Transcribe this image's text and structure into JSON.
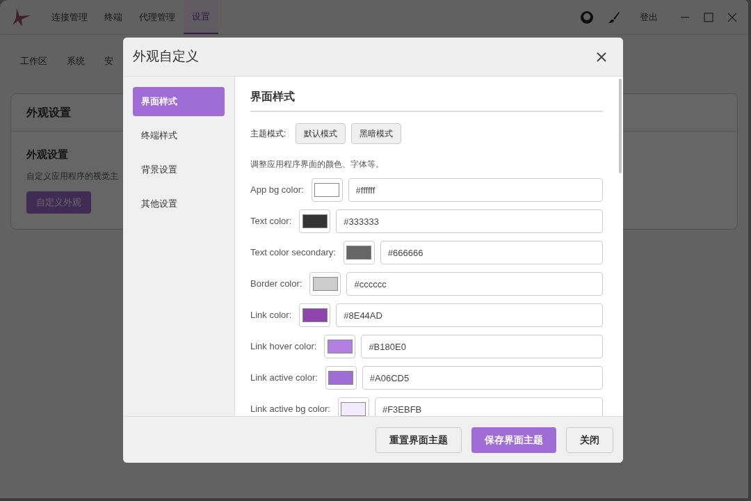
{
  "header": {
    "nav": [
      {
        "label": "连接管理",
        "selected": false
      },
      {
        "label": "终端",
        "selected": false
      },
      {
        "label": "代理管理",
        "selected": false
      },
      {
        "label": "设置",
        "selected": true
      }
    ],
    "logout": "登出"
  },
  "subtabs": [
    {
      "label": "工作区"
    },
    {
      "label": "系统"
    },
    {
      "label": "安"
    }
  ],
  "card": {
    "title": "外观设置",
    "section_title": "外观设置",
    "description": "自定义应用程序的视觉主",
    "button": "自定义外观"
  },
  "dialog": {
    "title": "外观自定义",
    "sidebar": [
      {
        "label": "界面样式",
        "selected": true
      },
      {
        "label": "终端样式",
        "selected": false
      },
      {
        "label": "背景设置",
        "selected": false
      },
      {
        "label": "其他设置",
        "selected": false
      }
    ],
    "heading": "界面样式",
    "theme_mode": {
      "label": "主题模式:",
      "options": [
        "默认模式",
        "黑暗模式"
      ]
    },
    "description": "调整应用程序界面的颜色、字体等。",
    "fields": [
      {
        "label": "App bg color:",
        "color": "#ffffff",
        "value": "#ffffff"
      },
      {
        "label": "Text color:",
        "color": "#333333",
        "value": "#333333"
      },
      {
        "label": "Text color secondary:",
        "color": "#666666",
        "value": "#666666"
      },
      {
        "label": "Border color:",
        "color": "#cccccc",
        "value": "#cccccc"
      },
      {
        "label": "Link color:",
        "color": "#8e44ad",
        "value": "#8E44AD"
      },
      {
        "label": "Link hover color:",
        "color": "#b180e0",
        "value": "#B180E0"
      },
      {
        "label": "Link active color:",
        "color": "#a06cd5",
        "value": "#A06CD5"
      },
      {
        "label": "Link active bg color:",
        "color": "#f3ebfb",
        "value": "#F3EBFB"
      }
    ],
    "buttons": [
      {
        "label": "重置界面主题",
        "kind": "default"
      },
      {
        "label": "保存界面主题",
        "kind": "primary"
      },
      {
        "label": "关闭",
        "kind": "default"
      }
    ]
  }
}
